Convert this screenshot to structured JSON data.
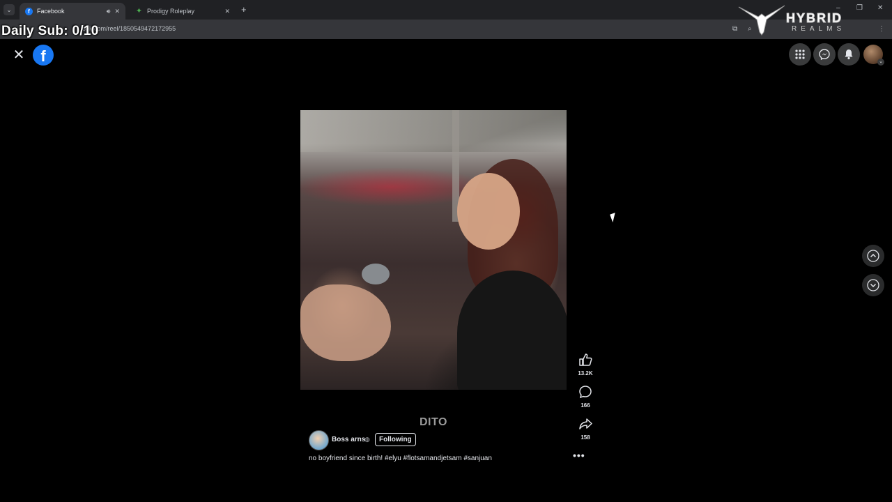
{
  "browser": {
    "tabs": [
      {
        "title": "Facebook",
        "active": true
      },
      {
        "title": "Prodigy Roleplay",
        "active": false
      }
    ],
    "new_tab_label": "+",
    "url": "ook.com/reel/1850549472172955",
    "window_controls": {
      "minimize": "–",
      "restore": "❐",
      "close": "✕"
    }
  },
  "overlay": {
    "daily_sub": "Daily Sub: 0/10",
    "watermark_title": "HYBRID",
    "watermark_subtitle": "REALMS"
  },
  "facebook": {
    "close_glyph": "✕",
    "logo_glyph": "f",
    "top_icons": [
      "apps-grid-icon",
      "messenger-icon",
      "notifications-bell-icon",
      "account-avatar"
    ]
  },
  "reel": {
    "overlay_text": "DITO",
    "author": {
      "name": "Boss arns",
      "follow_label": "Following"
    },
    "caption": "no boyfriend since birth! #elyu #flotsamandjetsam #sanjuan",
    "likes": "13.2K",
    "comments": "166",
    "shares": "158",
    "more_glyph": "•••"
  },
  "colors": {
    "brand": "#1877f2",
    "background": "#000000",
    "text": "#e4e6eb"
  }
}
